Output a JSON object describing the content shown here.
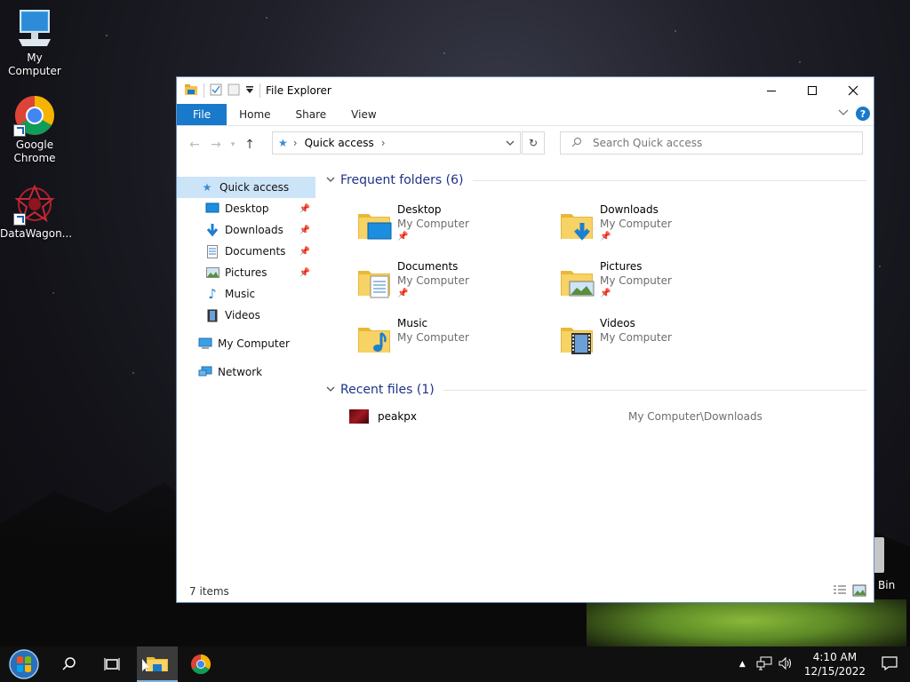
{
  "desktop": {
    "icons": [
      {
        "label": "My Computer"
      },
      {
        "label": "Google Chrome"
      },
      {
        "label": "DataWagon..."
      }
    ],
    "recycle_bin_label": "Bin"
  },
  "window": {
    "title": "File Explorer",
    "ribbon_tabs": [
      "File",
      "Home",
      "Share",
      "View"
    ],
    "address": {
      "crumb": "Quick access"
    },
    "search_placeholder": "Search Quick access",
    "status": "7 items"
  },
  "sidebar": {
    "items": [
      {
        "label": "Quick access",
        "pinned": false
      },
      {
        "label": "Desktop",
        "pinned": true
      },
      {
        "label": "Downloads",
        "pinned": true
      },
      {
        "label": "Documents",
        "pinned": true
      },
      {
        "label": "Pictures",
        "pinned": true
      },
      {
        "label": "Music",
        "pinned": false
      },
      {
        "label": "Videos",
        "pinned": false
      },
      {
        "label": "My Computer",
        "pinned": false
      },
      {
        "label": "Network",
        "pinned": false
      }
    ]
  },
  "frequent": {
    "header": "Frequent folders (6)",
    "folders": [
      {
        "name": "Desktop",
        "location": "My Computer",
        "pinned": true
      },
      {
        "name": "Downloads",
        "location": "My Computer",
        "pinned": true
      },
      {
        "name": "Documents",
        "location": "My Computer",
        "pinned": true
      },
      {
        "name": "Pictures",
        "location": "My Computer",
        "pinned": true
      },
      {
        "name": "Music",
        "location": "My Computer",
        "pinned": false
      },
      {
        "name": "Videos",
        "location": "My Computer",
        "pinned": false
      }
    ]
  },
  "recent": {
    "header": "Recent files (1)",
    "files": [
      {
        "name": "peakpx",
        "path": "My Computer\\Downloads"
      }
    ]
  },
  "taskbar": {
    "time": "4:10 AM",
    "date": "12/15/2022"
  },
  "colors": {
    "accent": "#1979ca",
    "section_header": "#1e3287",
    "selected_bg": "#cce4f7"
  }
}
